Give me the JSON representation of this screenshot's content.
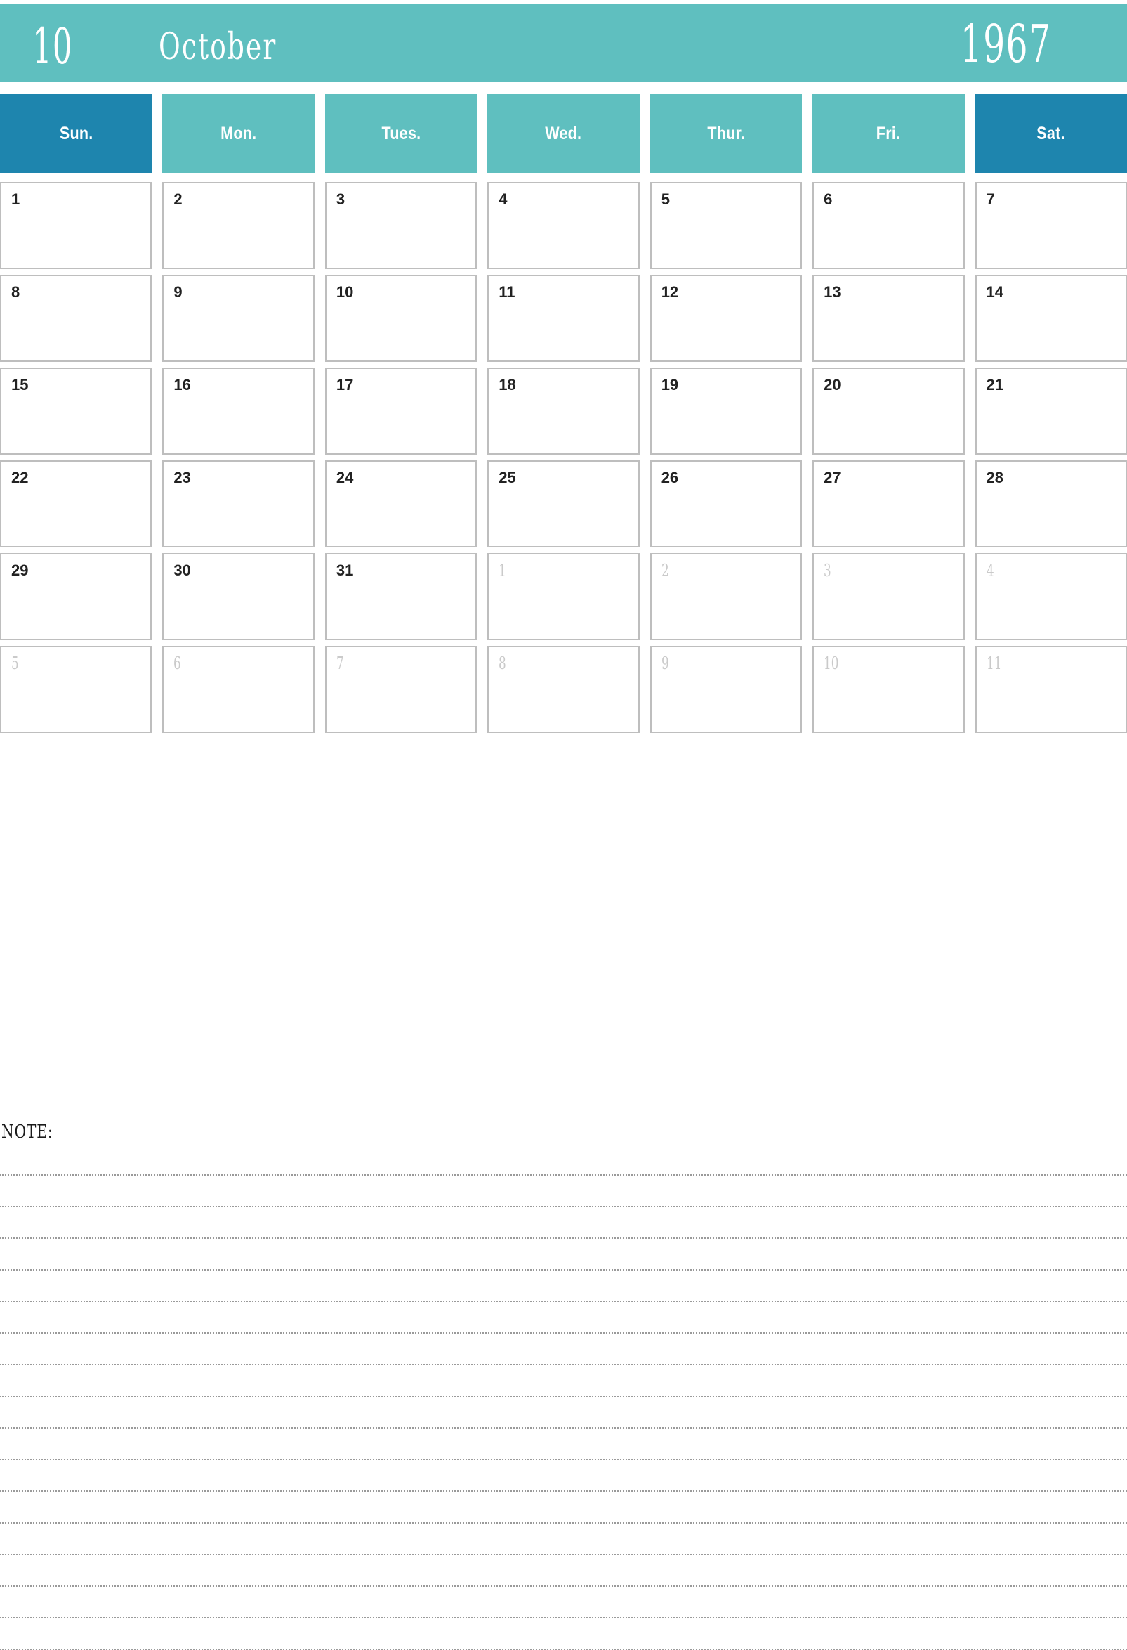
{
  "header": {
    "month_number": "10",
    "month_name": "October",
    "year": "1967",
    "banner_color": "#5FBFBF"
  },
  "weekdays": [
    {
      "label": "Sun.",
      "weekend": true,
      "color": "#1E85AE"
    },
    {
      "label": "Mon.",
      "weekend": false,
      "color": "#5FBFBF"
    },
    {
      "label": "Tues.",
      "weekend": false,
      "color": "#5FBFBF"
    },
    {
      "label": "Wed.",
      "weekend": false,
      "color": "#5FBFBF"
    },
    {
      "label": "Thur.",
      "weekend": false,
      "color": "#5FBFBF"
    },
    {
      "label": "Fri.",
      "weekend": false,
      "color": "#5FBFBF"
    },
    {
      "label": "Sat.",
      "weekend": true,
      "color": "#1E85AE"
    }
  ],
  "grid": {
    "weeks": [
      [
        {
          "day": "1",
          "current": true
        },
        {
          "day": "2",
          "current": true
        },
        {
          "day": "3",
          "current": true
        },
        {
          "day": "4",
          "current": true
        },
        {
          "day": "5",
          "current": true
        },
        {
          "day": "6",
          "current": true
        },
        {
          "day": "7",
          "current": true
        }
      ],
      [
        {
          "day": "8",
          "current": true
        },
        {
          "day": "9",
          "current": true
        },
        {
          "day": "10",
          "current": true
        },
        {
          "day": "11",
          "current": true
        },
        {
          "day": "12",
          "current": true
        },
        {
          "day": "13",
          "current": true
        },
        {
          "day": "14",
          "current": true
        }
      ],
      [
        {
          "day": "15",
          "current": true
        },
        {
          "day": "16",
          "current": true
        },
        {
          "day": "17",
          "current": true
        },
        {
          "day": "18",
          "current": true
        },
        {
          "day": "19",
          "current": true
        },
        {
          "day": "20",
          "current": true
        },
        {
          "day": "21",
          "current": true
        }
      ],
      [
        {
          "day": "22",
          "current": true
        },
        {
          "day": "23",
          "current": true
        },
        {
          "day": "24",
          "current": true
        },
        {
          "day": "25",
          "current": true
        },
        {
          "day": "26",
          "current": true
        },
        {
          "day": "27",
          "current": true
        },
        {
          "day": "28",
          "current": true
        }
      ],
      [
        {
          "day": "29",
          "current": true
        },
        {
          "day": "30",
          "current": true
        },
        {
          "day": "31",
          "current": true
        },
        {
          "day": "1",
          "current": false
        },
        {
          "day": "2",
          "current": false
        },
        {
          "day": "3",
          "current": false
        },
        {
          "day": "4",
          "current": false
        }
      ],
      [
        {
          "day": "5",
          "current": false
        },
        {
          "day": "6",
          "current": false
        },
        {
          "day": "7",
          "current": false
        },
        {
          "day": "8",
          "current": false
        },
        {
          "day": "9",
          "current": false
        },
        {
          "day": "10",
          "current": false
        },
        {
          "day": "11",
          "current": false
        }
      ]
    ]
  },
  "note": {
    "label": "NOTE:",
    "line_count": 16
  },
  "colors": {
    "teal": "#5FBFBF",
    "blue": "#1E85AE",
    "cell_border": "#BEBEBE",
    "day_text": "#222222",
    "other_month_text": "#CACACA",
    "note_line": "#9a9a9a"
  }
}
